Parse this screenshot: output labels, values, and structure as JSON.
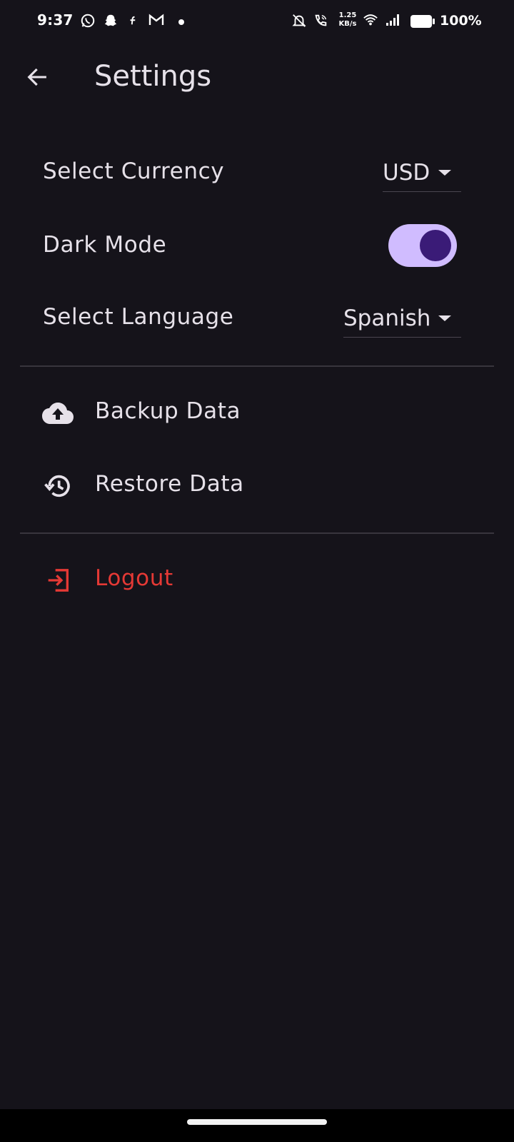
{
  "status_bar": {
    "time": "9:37",
    "net_speed_value": "1.25",
    "net_speed_unit": "KB/s",
    "battery": "100%",
    "icons": [
      "whatsapp-icon",
      "snapchat-icon",
      "app-icon",
      "gmail-icon",
      "dot-icon",
      "mute-icon",
      "wifi-call-icon",
      "wifi-icon",
      "signal-icon",
      "battery-icon"
    ]
  },
  "app_bar": {
    "title": "Settings",
    "back_icon": "arrow-left-icon"
  },
  "settings": {
    "currency": {
      "label": "Select Currency",
      "value": "USD"
    },
    "dark_mode": {
      "label": "Dark Mode",
      "enabled": true
    },
    "language": {
      "label": "Select Language",
      "value": "Spanish"
    }
  },
  "actions": {
    "backup": {
      "label": "Backup Data",
      "icon": "cloud-upload-icon"
    },
    "restore": {
      "label": "Restore Data",
      "icon": "history-icon"
    },
    "logout": {
      "label": "Logout",
      "icon": "logout-icon",
      "color": "#e53935"
    }
  },
  "colors": {
    "background": "#15131a",
    "toggle_track": "#d0bcff",
    "toggle_knob": "#3a1b77",
    "danger": "#e53935"
  }
}
